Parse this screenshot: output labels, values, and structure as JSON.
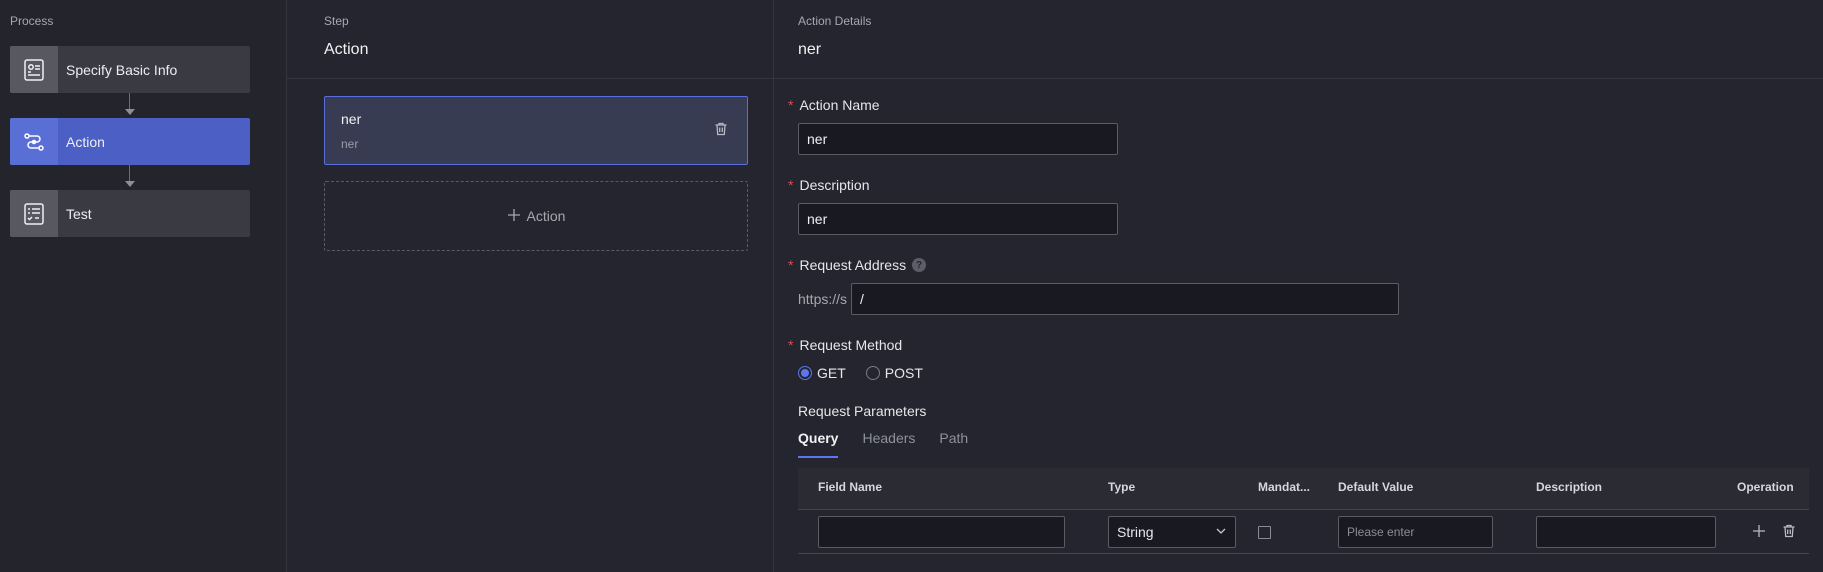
{
  "process": {
    "label": "Process",
    "steps": [
      {
        "label": "Specify Basic Info",
        "icon": "id-card-icon"
      },
      {
        "label": "Action",
        "icon": "route-icon"
      },
      {
        "label": "Test",
        "icon": "checklist-icon"
      }
    ]
  },
  "step_panel": {
    "label": "Step",
    "title": "Action",
    "card": {
      "name": "ner",
      "description": "ner"
    },
    "add_label": "Action"
  },
  "details": {
    "label": "Action Details",
    "title": "ner",
    "action_name": {
      "label": "Action Name",
      "value": "ner"
    },
    "description": {
      "label": "Description",
      "value": "ner"
    },
    "request_address": {
      "label": "Request Address",
      "prefix": "https://s",
      "value": "/"
    },
    "request_method": {
      "label": "Request Method",
      "options": [
        "GET",
        "POST"
      ],
      "selected": "GET"
    },
    "params": {
      "label": "Request Parameters",
      "tabs": [
        "Query",
        "Headers",
        "Path"
      ],
      "active_tab": "Query",
      "columns": [
        "Field Name",
        "Type",
        "Mandat...",
        "Default Value",
        "Description",
        "Operation"
      ],
      "row": {
        "type": "String",
        "default_placeholder": "Please enter",
        "field_name": "",
        "description": ""
      }
    }
  },
  "colors": {
    "accent": "#4b5fc4",
    "required": "#e5484d",
    "background": "#24252e"
  }
}
